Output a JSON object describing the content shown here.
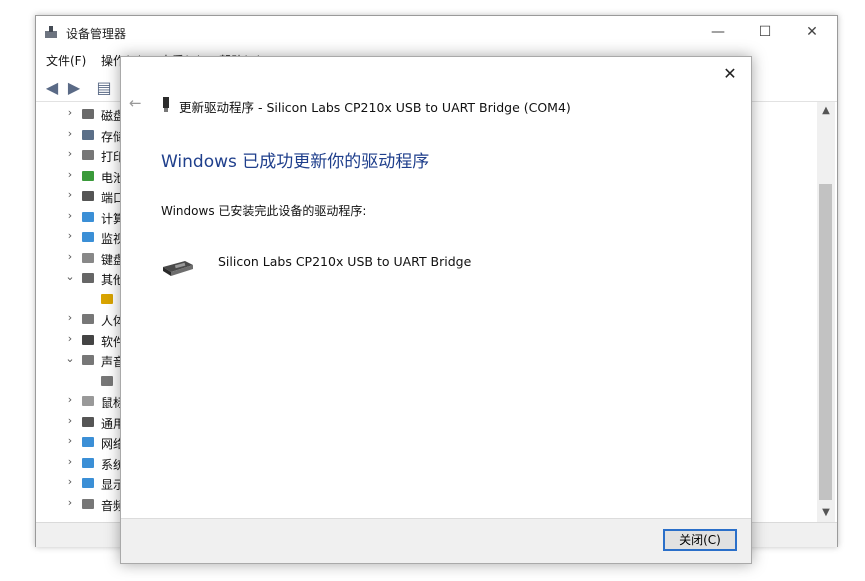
{
  "device_manager": {
    "title": "设备管理器",
    "menu": [
      "文件(F)",
      "操作(A)",
      "查看(V)",
      "帮助(H)"
    ],
    "window_buttons": {
      "minimize": "—",
      "maximize": "☐",
      "close": "✕"
    },
    "tree": [
      {
        "label": "磁盘驱动器",
        "expander": "›",
        "icon": "disk-drive-icon"
      },
      {
        "label": "存储控制器",
        "expander": "›",
        "icon": "storage-controller-icon"
      },
      {
        "label": "打印队列",
        "expander": "›",
        "icon": "printer-icon"
      },
      {
        "label": "电池",
        "expander": "›",
        "icon": "battery-icon"
      },
      {
        "label": "端口 (COM 和 LPT)",
        "expander": "›",
        "icon": "port-icon"
      },
      {
        "label": "计算机",
        "expander": "›",
        "icon": "computer-icon"
      },
      {
        "label": "监视器",
        "expander": "›",
        "icon": "monitor-icon"
      },
      {
        "label": "键盘",
        "expander": "›",
        "icon": "keyboard-icon"
      },
      {
        "label": "其他设备",
        "expander": "⌄",
        "icon": "unknown-device-icon"
      },
      {
        "label": "",
        "expander": "",
        "icon": "warning-device-icon"
      },
      {
        "label": "人体学输入设备",
        "expander": "›",
        "icon": "hid-icon"
      },
      {
        "label": "软件设备",
        "expander": "›",
        "icon": "software-device-icon"
      },
      {
        "label": "声音输入和输出",
        "expander": "⌄",
        "icon": "speaker-icon"
      },
      {
        "label": "",
        "expander": "",
        "icon": "speaker-icon"
      },
      {
        "label": "鼠标和其他指针设备",
        "expander": "›",
        "icon": "mouse-icon"
      },
      {
        "label": "通用串行总线控制器",
        "expander": "›",
        "icon": "usb-icon"
      },
      {
        "label": "网络适配器",
        "expander": "›",
        "icon": "network-icon"
      },
      {
        "label": "系统设备",
        "expander": "›",
        "icon": "system-icon"
      },
      {
        "label": "显示适配器",
        "expander": "›",
        "icon": "display-adapter-icon"
      },
      {
        "label": "音频输入和输出",
        "expander": "›",
        "icon": "audio-icon"
      }
    ]
  },
  "dialog": {
    "close_glyph": "✕",
    "back_glyph": "←",
    "title": "更新驱动程序 - Silicon Labs CP210x USB to UART Bridge (COM4)",
    "heading": "Windows 已成功更新你的驱动程序",
    "description": "Windows 已安装完此设备的驱动程序:",
    "device_name": "Silicon Labs CP210x USB to UART Bridge",
    "close_button": "关闭(C)"
  },
  "colors": {
    "heading": "#1f3f8c",
    "button_focus": "#2a6fc9"
  }
}
